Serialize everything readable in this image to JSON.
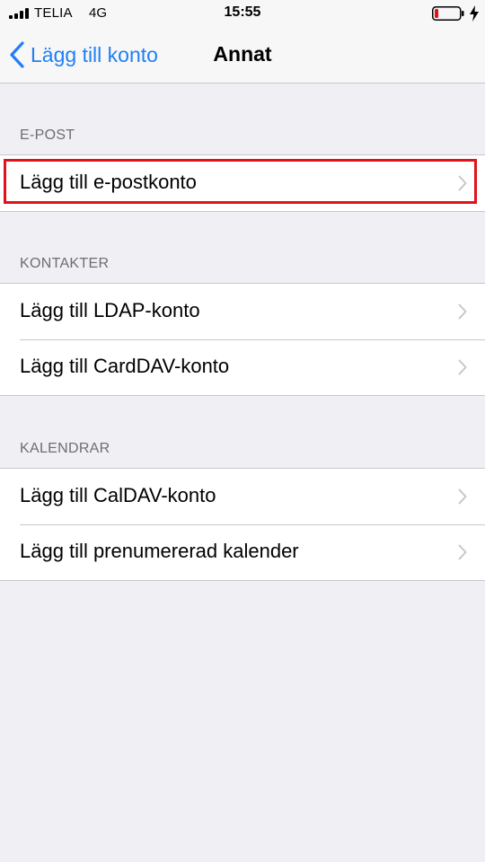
{
  "status_bar": {
    "carrier": "TELIA",
    "network": "4G",
    "time": "15:55",
    "battery_level": 0.15,
    "charging": true,
    "icons": [
      "signal-icon",
      "battery-icon",
      "charging-bolt-icon"
    ]
  },
  "nav": {
    "back_label": "Lägg till konto",
    "title": "Annat",
    "accent_color": "#1f7ff7"
  },
  "sections": [
    {
      "header": "E-POST",
      "items": [
        {
          "label": "Lägg till e-postkonto",
          "highlighted": true
        }
      ]
    },
    {
      "header": "KONTAKTER",
      "items": [
        {
          "label": "Lägg till LDAP-konto"
        },
        {
          "label": "Lägg till CardDAV-konto"
        }
      ]
    },
    {
      "header": "KALENDRAR",
      "items": [
        {
          "label": "Lägg till CalDAV-konto"
        },
        {
          "label": "Lägg till prenumererad kalender"
        }
      ]
    }
  ],
  "highlight_color": "#e2121b"
}
